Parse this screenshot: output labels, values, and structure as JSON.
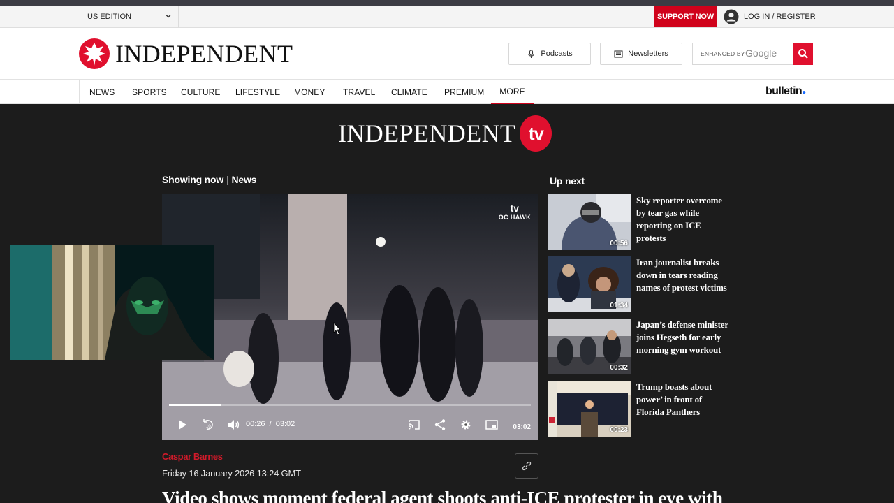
{
  "utility_bar": {
    "edition_label": "US EDITION",
    "support_label": "SUPPORT NOW",
    "login_label": "LOG IN / REGISTER"
  },
  "masthead": {
    "logo_text": "INDEPENDENT",
    "podcasts_label": "Podcasts",
    "newsletters_label": "Newsletters",
    "search": {
      "enhanced_label": "ENHANCED BY",
      "google_label": "Google"
    }
  },
  "nav": {
    "items": [
      "NEWS",
      "SPORTS",
      "CULTURE",
      "LIFESTYLE",
      "MONEY",
      "TRAVEL",
      "CLIMATE",
      "PREMIUM",
      "MORE"
    ],
    "active": "MORE",
    "bulletin_label": "bulletin"
  },
  "tv": {
    "logo_text": "INDEPENDENT",
    "tv_badge": "tv"
  },
  "showing": {
    "prefix": "Showing now",
    "section": "News"
  },
  "video": {
    "watermark_logo": "tv",
    "watermark_source": "OC HAWK",
    "current_time": "00:26",
    "separator": "/",
    "total_time": "03:02",
    "duration_badge": "03:02",
    "progress_fraction": 0.143
  },
  "up_next": {
    "title": "Up next",
    "items": [
      {
        "title": "Sky reporter overcome by tear gas while reporting on ICE protests",
        "duration": "00:56"
      },
      {
        "title": "Iran journalist breaks down in tears reading names of protest victims",
        "duration": "01:34"
      },
      {
        "title": "Japan’s defense minister joins Hegseth for early morning gym workout",
        "duration": "00:32"
      },
      {
        "title": "Trump boasts about power’ in front of Florida Panthers",
        "duration": "00:23"
      }
    ]
  },
  "article": {
    "author": "Caspar Barnes",
    "date": "Friday 16 January 2026 13:24 GMT",
    "headline": "Video shows moment federal agent shoots anti-ICE protester in eye with"
  },
  "colors": {
    "brand_red": "#d0021b",
    "dark_bg": "#1c1c1c"
  }
}
